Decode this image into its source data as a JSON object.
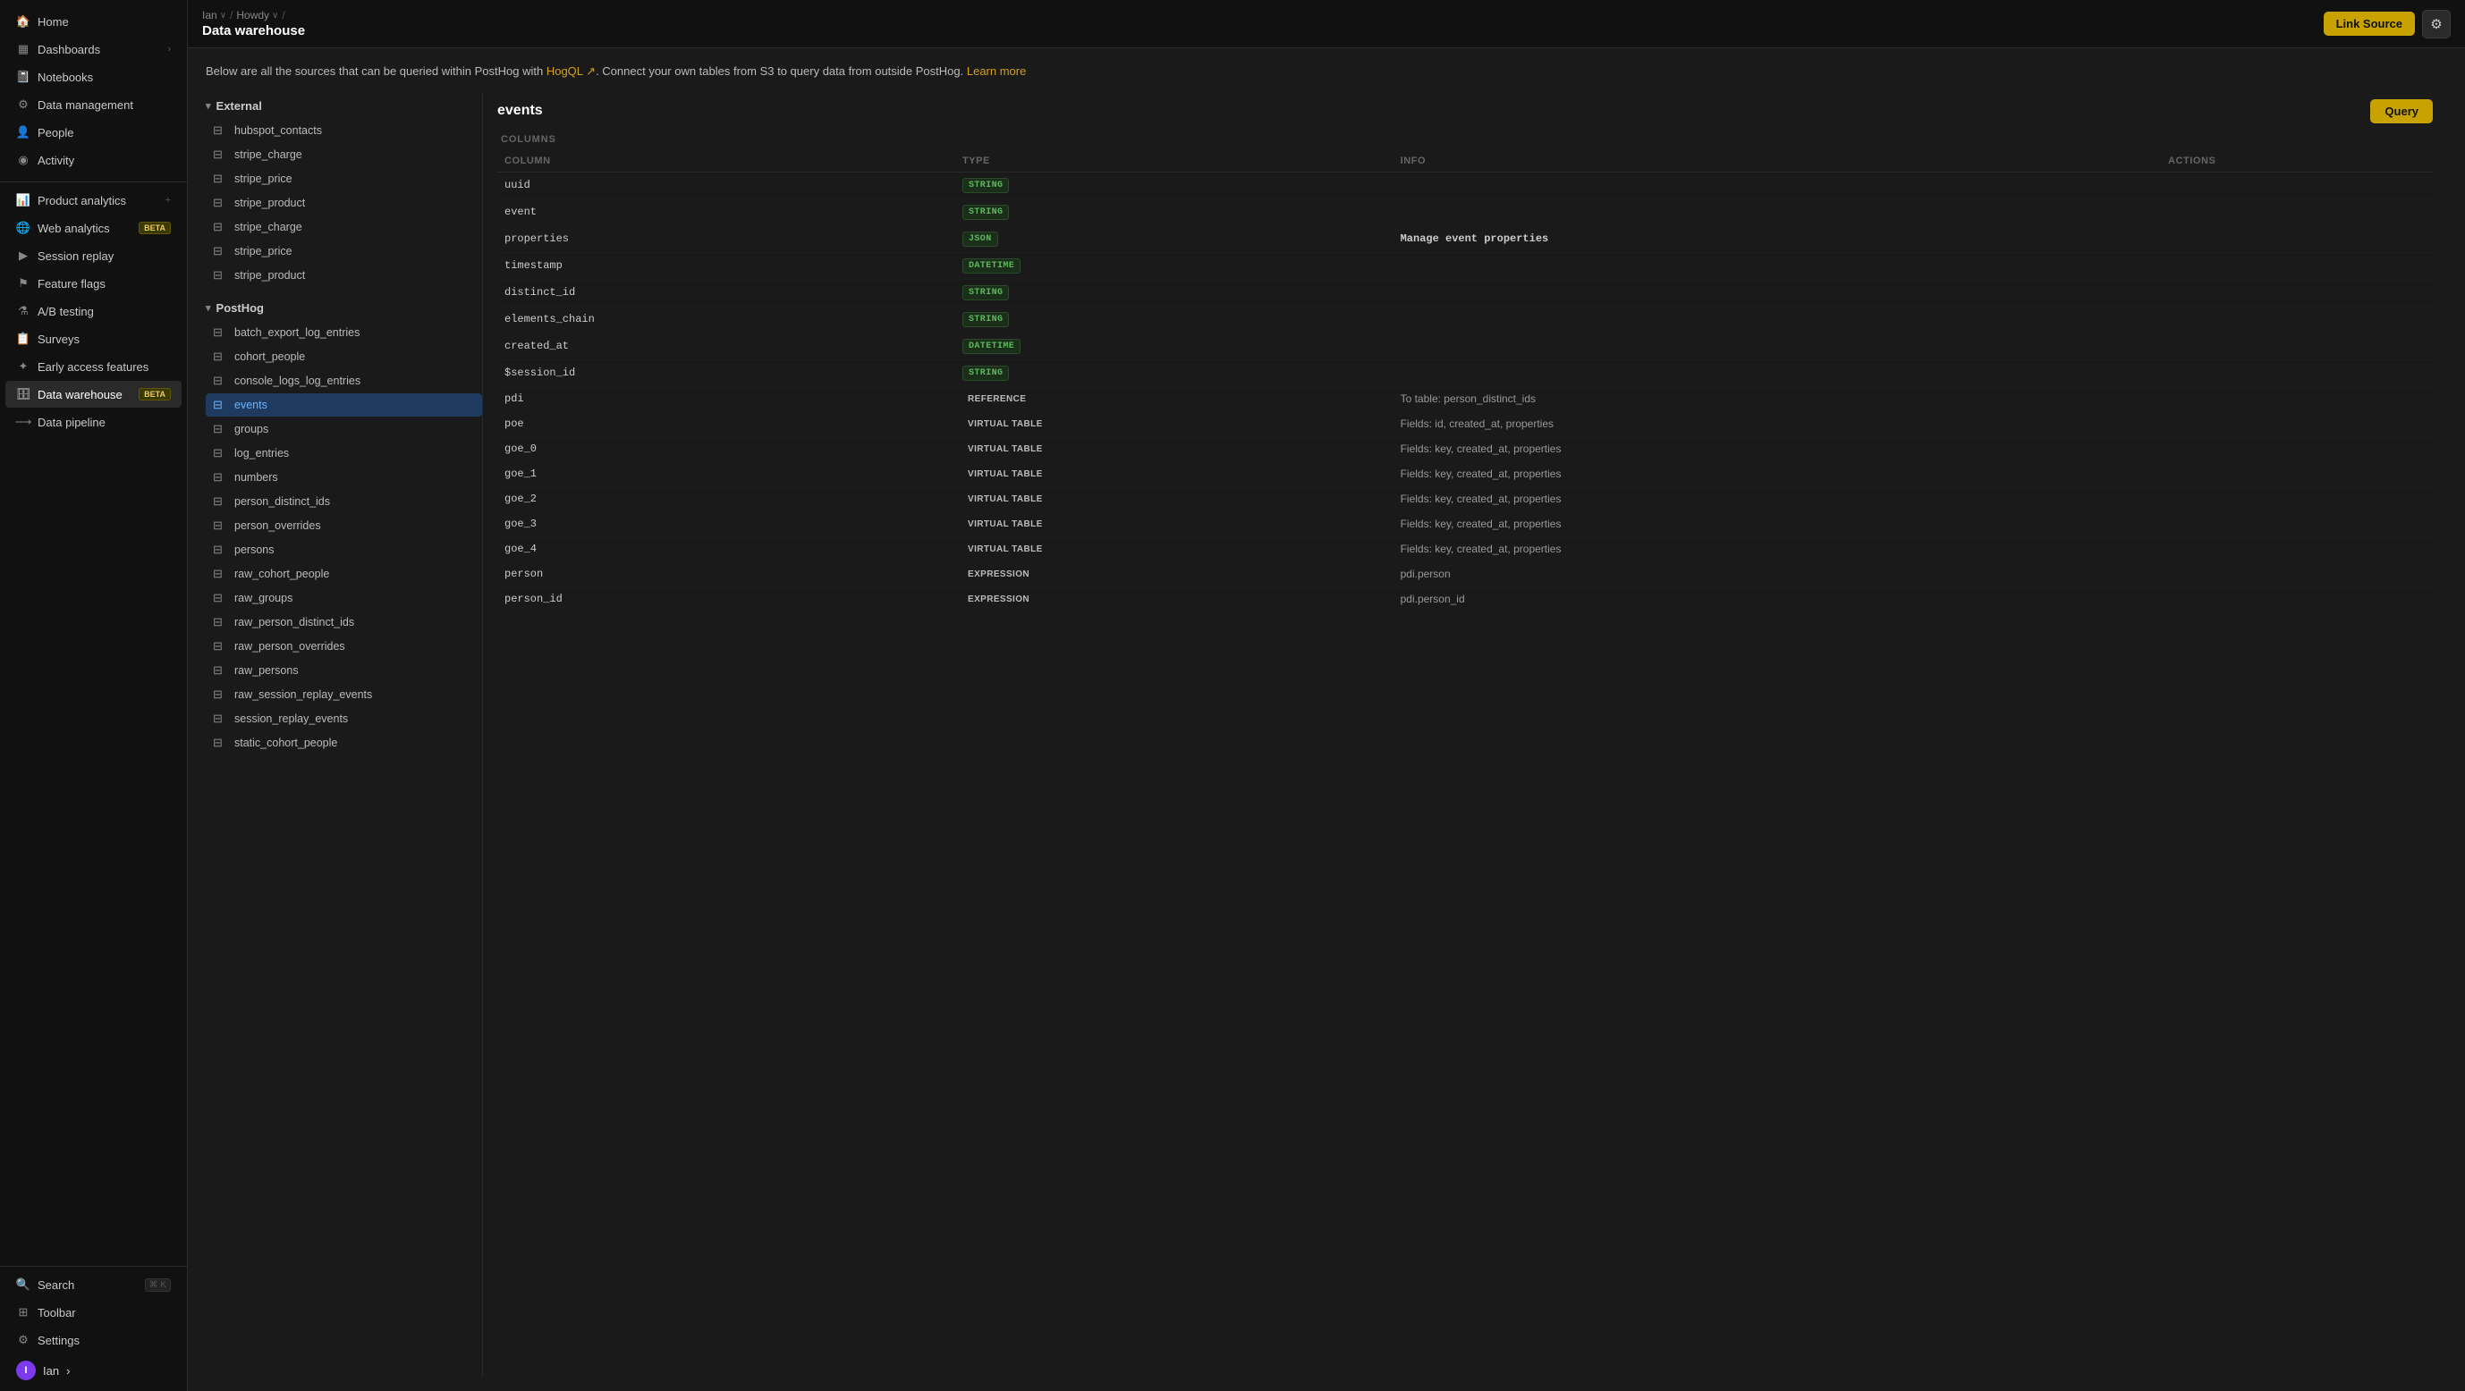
{
  "sidebar": {
    "top_items": [
      {
        "id": "home",
        "label": "Home",
        "icon": "🏠"
      },
      {
        "id": "dashboards",
        "label": "Dashboards",
        "icon": "▦",
        "has_chevron": true
      },
      {
        "id": "notebooks",
        "label": "Notebooks",
        "icon": "📓"
      },
      {
        "id": "data-management",
        "label": "Data management",
        "icon": "⚙"
      },
      {
        "id": "people",
        "label": "People",
        "icon": "👤"
      },
      {
        "id": "activity",
        "label": "Activity",
        "icon": "◉"
      }
    ],
    "analytics_items": [
      {
        "id": "product-analytics",
        "label": "Product analytics",
        "icon": "📊",
        "has_plus": true
      },
      {
        "id": "web-analytics",
        "label": "Web analytics",
        "icon": "🌐",
        "badge": "BETA"
      },
      {
        "id": "session-replay",
        "label": "Session replay",
        "icon": "▶"
      },
      {
        "id": "feature-flags",
        "label": "Feature flags",
        "icon": "⚑"
      },
      {
        "id": "ab-testing",
        "label": "A/B testing",
        "icon": "⚗"
      },
      {
        "id": "surveys",
        "label": "Surveys",
        "icon": "📋"
      },
      {
        "id": "early-access",
        "label": "Early access features",
        "icon": "✦"
      },
      {
        "id": "data-warehouse",
        "label": "Data warehouse",
        "icon": "🗄",
        "badge": "BETA",
        "active": true
      },
      {
        "id": "data-pipeline",
        "label": "Data pipeline",
        "icon": "⟶"
      }
    ],
    "bottom_items": [
      {
        "id": "search",
        "label": "Search",
        "icon": "🔍",
        "kbd": "⌘ K"
      },
      {
        "id": "toolbar",
        "label": "Toolbar",
        "icon": "⊞"
      },
      {
        "id": "settings",
        "label": "Settings",
        "icon": "⚙"
      }
    ],
    "user": {
      "label": "Ian",
      "initial": "I"
    }
  },
  "header": {
    "breadcrumbs": [
      {
        "label": "Ian",
        "has_chevron": true
      },
      {
        "label": "Howdy",
        "has_chevron": true
      }
    ],
    "title": "Data warehouse",
    "link_source_label": "Link Source",
    "gear_icon": "⚙"
  },
  "description": {
    "text_before": "Below are all the sources that can be queried within PostHog with ",
    "hogql_label": "HogQL",
    "text_after": ". Connect your own tables from S3 to query data from outside PostHog.",
    "learn_more": "Learn more"
  },
  "external_section": {
    "label": "External",
    "tables": [
      "hubspot_contacts",
      "stripe_charge",
      "stripe_price",
      "stripe_product",
      "stripe_charge",
      "stripe_price",
      "stripe_product"
    ]
  },
  "posthog_section": {
    "label": "PostHog",
    "tables": [
      "batch_export_log_entries",
      "cohort_people",
      "console_logs_log_entries",
      "events",
      "groups",
      "log_entries",
      "numbers",
      "person_distinct_ids",
      "person_overrides",
      "persons",
      "raw_cohort_people",
      "raw_groups",
      "raw_person_distinct_ids",
      "raw_person_overrides",
      "raw_persons",
      "raw_session_replay_events",
      "session_replay_events",
      "static_cohort_people"
    ],
    "active_table": "events"
  },
  "detail": {
    "title": "events",
    "query_label": "Query",
    "columns_label": "COLUMNS",
    "headers": [
      "COLUMN",
      "TYPE",
      "INFO",
      "ACTIONS"
    ],
    "rows": [
      {
        "column": "uuid",
        "type": "STRING",
        "type_class": "type-string",
        "info": ""
      },
      {
        "column": "event",
        "type": "STRING",
        "type_class": "type-string",
        "info": ""
      },
      {
        "column": "properties",
        "type": "JSON",
        "type_class": "type-json",
        "info": "Manage event properties",
        "info_bold": true
      },
      {
        "column": "timestamp",
        "type": "DATETIME",
        "type_class": "type-datetime",
        "info": ""
      },
      {
        "column": "distinct_id",
        "type": "STRING",
        "type_class": "type-string",
        "info": ""
      },
      {
        "column": "elements_chain",
        "type": "STRING",
        "type_class": "type-string",
        "info": ""
      },
      {
        "column": "created_at",
        "type": "DATETIME",
        "type_class": "type-datetime",
        "info": ""
      },
      {
        "column": "$session_id",
        "type": "STRING",
        "type_class": "type-string",
        "info": ""
      },
      {
        "column": "pdi",
        "type": "REFERENCE",
        "type_class": "type-reference",
        "info": "To table: person_distinct_ids"
      },
      {
        "column": "poe",
        "type": "VIRTUAL TABLE",
        "type_class": "type-virtual",
        "info": "Fields: id, created_at, properties"
      },
      {
        "column": "goe_0",
        "type": "VIRTUAL TABLE",
        "type_class": "type-virtual",
        "info": "Fields: key, created_at, properties"
      },
      {
        "column": "goe_1",
        "type": "VIRTUAL TABLE",
        "type_class": "type-virtual",
        "info": "Fields: key, created_at, properties"
      },
      {
        "column": "goe_2",
        "type": "VIRTUAL TABLE",
        "type_class": "type-virtual",
        "info": "Fields: key, created_at, properties"
      },
      {
        "column": "goe_3",
        "type": "VIRTUAL TABLE",
        "type_class": "type-virtual",
        "info": "Fields: key, created_at, properties"
      },
      {
        "column": "goe_4",
        "type": "VIRTUAL TABLE",
        "type_class": "type-virtual",
        "info": "Fields: key, created_at, properties"
      },
      {
        "column": "person",
        "type": "EXPRESSION",
        "type_class": "type-expression",
        "info": "pdi.person"
      },
      {
        "column": "person_id",
        "type": "EXPRESSION",
        "type_class": "type-expression",
        "info": "pdi.person_id"
      }
    ]
  }
}
